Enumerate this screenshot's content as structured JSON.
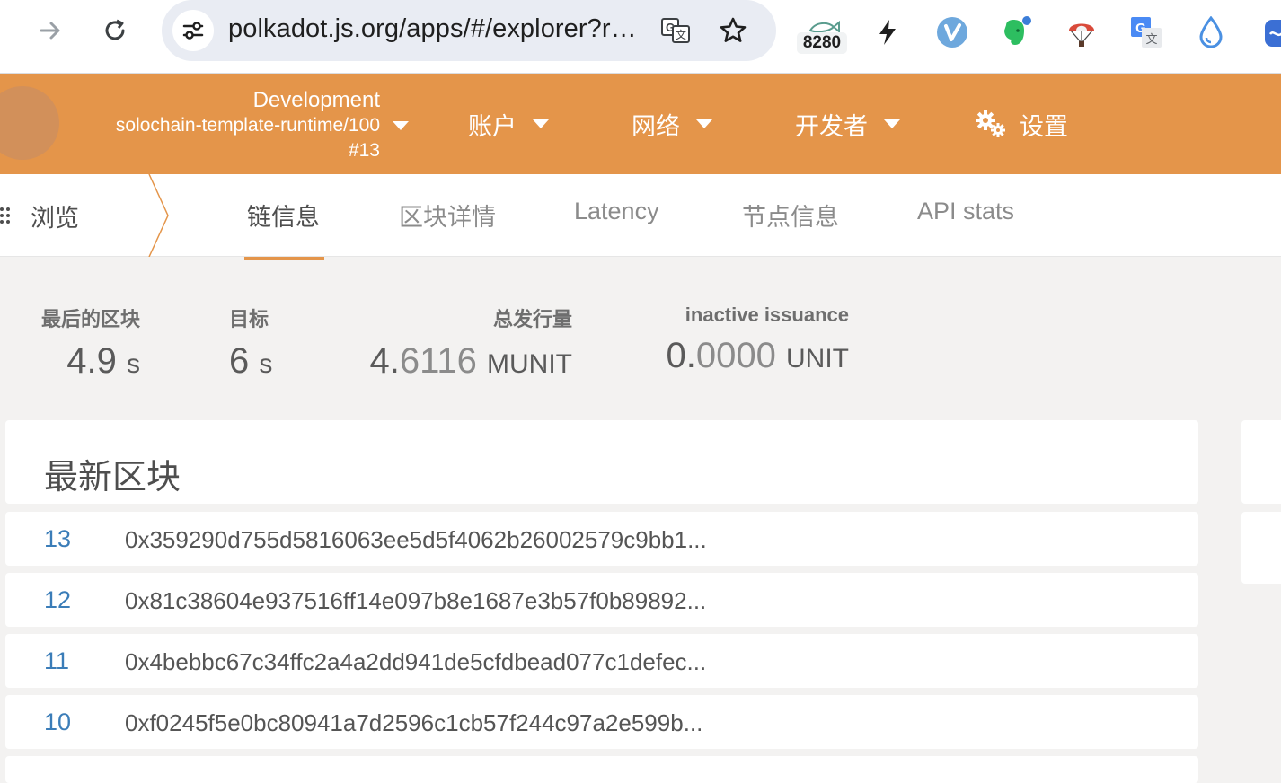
{
  "browser": {
    "url": "polkadot.js.org/apps/#/explorer?rpc=ws://127.0.0.1:9944",
    "extension_badge": "8280",
    "icons": [
      "forward-icon",
      "reload-icon",
      "site-settings-icon",
      "translate-icon",
      "bookmark-star-icon",
      "lightning-icon",
      "v-extension-icon",
      "evernote-icon",
      "parachute-icon",
      "google-translate-icon",
      "drop-icon"
    ]
  },
  "header": {
    "chain_name": "Development",
    "runtime": "solochain-template-runtime/100",
    "block": "#13",
    "menu": [
      {
        "label": "账户",
        "icon": "caret-down-icon"
      },
      {
        "label": "网络",
        "icon": "caret-down-icon"
      },
      {
        "label": "开发者",
        "icon": "caret-down-icon"
      },
      {
        "label": "设置",
        "icon": "gears-icon"
      }
    ],
    "accent_color": "#e4954a"
  },
  "tabs": {
    "root_label": "浏览",
    "items": [
      "链信息",
      "区块详情",
      "Latency",
      "节点信息",
      "API stats"
    ],
    "active": "链信息"
  },
  "summary": {
    "last_block": {
      "label": "最后的区块",
      "value": "4.9",
      "unit": "s"
    },
    "target": {
      "label": "目标",
      "value": "6",
      "unit": "s"
    },
    "total_issuance": {
      "label": "总发行量",
      "value_int": "4.",
      "value_dec": "6116",
      "unit": "MUNIT"
    },
    "inactive_issuance": {
      "label": "inactive issuance",
      "value_int": "0.",
      "value_dec": "0000",
      "unit": "UNIT"
    }
  },
  "recent_blocks": {
    "title": "最新区块",
    "rows": [
      {
        "number": "13",
        "hash": "0x359290d755d5816063ee5d5f4062b26002579c9bb1..."
      },
      {
        "number": "12",
        "hash": "0x81c38604e937516ff14e097b8e1687e3b57f0b89892..."
      },
      {
        "number": "11",
        "hash": "0x4bebbc67c34ffc2a4a2dd941de5cfdbead077c1defec..."
      },
      {
        "number": "10",
        "hash": "0xf0245f5e0bc80941a7d2596c1cb57f244c97a2e599b..."
      }
    ]
  }
}
